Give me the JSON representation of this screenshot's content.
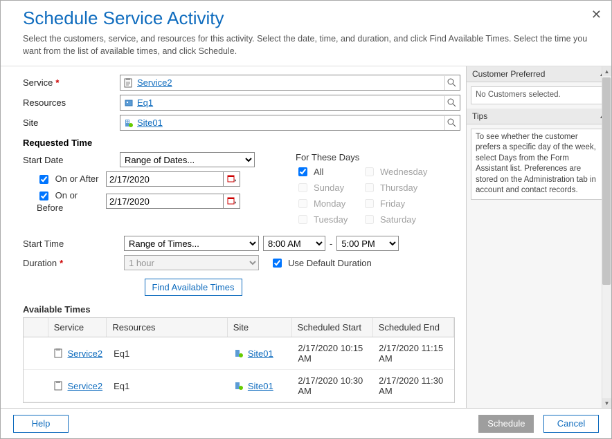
{
  "dialog": {
    "title": "Schedule Service Activity",
    "description": "Select the customers, service, and resources for this activity. Select the date, time, and duration, and click Find Available Times. Select the time you want from the list of available times, and click Schedule."
  },
  "form": {
    "service_label": "Service",
    "service_value": "Service2",
    "resources_label": "Resources",
    "resources_value": "Eq1",
    "site_label": "Site",
    "site_value": "Site01",
    "requested_time_label": "Requested Time",
    "start_date_label": "Start Date",
    "start_date_mode": "Range of Dates...",
    "on_or_after_label": "On or After",
    "on_or_after_value": "2/17/2020",
    "on_or_before_label": "On or Before",
    "on_or_before_value": "2/17/2020",
    "for_these_days_label": "For These Days",
    "days": {
      "all": "All",
      "sunday": "Sunday",
      "monday": "Monday",
      "tuesday": "Tuesday",
      "wednesday": "Wednesday",
      "thursday": "Thursday",
      "friday": "Friday",
      "saturday": "Saturday"
    },
    "start_time_label": "Start Time",
    "start_time_mode": "Range of Times...",
    "start_time_from": "8:00 AM",
    "start_time_sep": "-",
    "start_time_to": "5:00 PM",
    "duration_label": "Duration",
    "duration_value": "1 hour",
    "use_default_duration_label": "Use Default Duration",
    "find_button": "Find Available Times",
    "available_times_label": "Available Times"
  },
  "grid": {
    "headers": {
      "service": "Service",
      "resources": "Resources",
      "site": "Site",
      "start": "Scheduled Start",
      "end": "Scheduled End"
    },
    "rows": [
      {
        "service": "Service2",
        "resources": "Eq1",
        "site": "Site01",
        "start": "2/17/2020 10:15 AM",
        "end": "2/17/2020 11:15 AM"
      },
      {
        "service": "Service2",
        "resources": "Eq1",
        "site": "Site01",
        "start": "2/17/2020 10:30 AM",
        "end": "2/17/2020 11:30 AM"
      }
    ]
  },
  "assist": {
    "customer_preferred_title": "Customer Preferred",
    "no_customers": "No Customers selected.",
    "tips_title": "Tips",
    "tips_body": "To see whether the customer prefers a specific day of the week, select Days from the Form Assistant list. Preferences are stored on the Administration tab in account and contact records."
  },
  "footer": {
    "help": "Help",
    "schedule": "Schedule",
    "cancel": "Cancel"
  }
}
